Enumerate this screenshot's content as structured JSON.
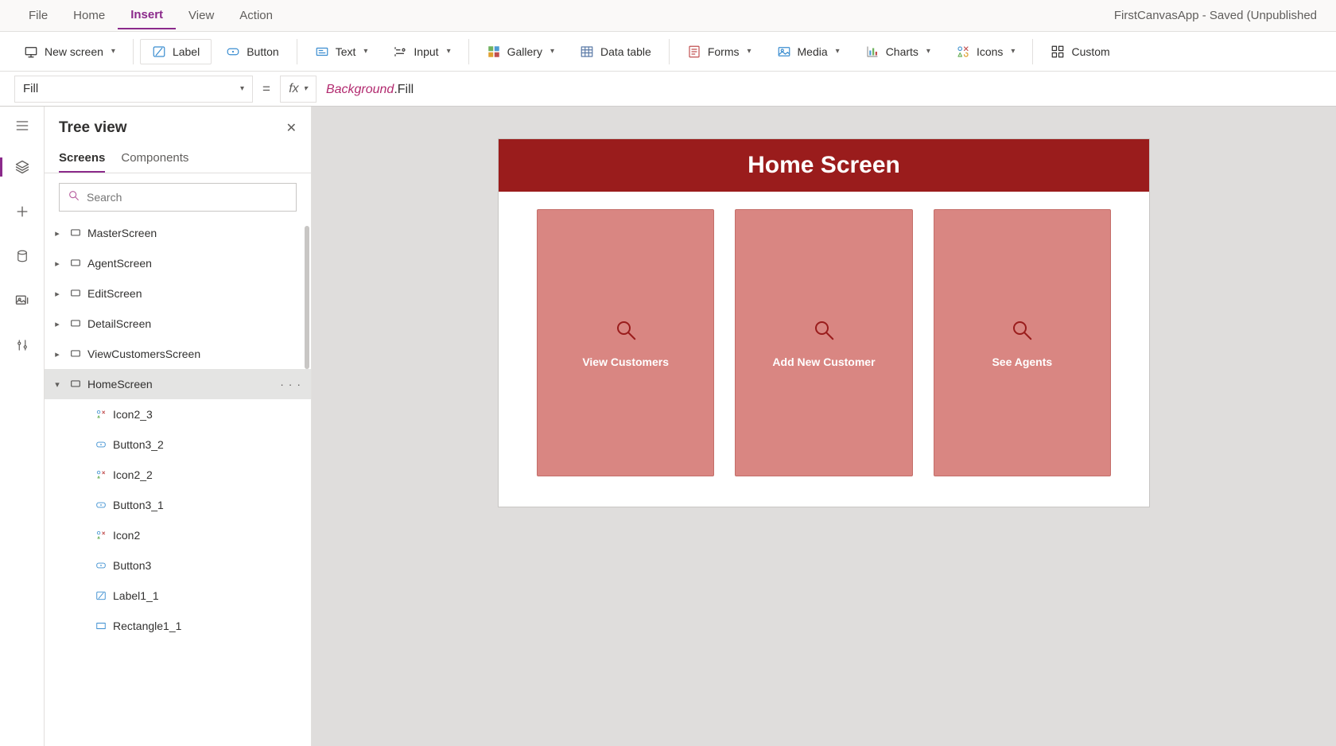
{
  "window": {
    "title": "FirstCanvasApp - Saved (Unpublished"
  },
  "menu": {
    "items": [
      "File",
      "Home",
      "Insert",
      "View",
      "Action"
    ],
    "active": "Insert"
  },
  "ribbon": {
    "new_screen": "New screen",
    "label": "Label",
    "button": "Button",
    "text": "Text",
    "input": "Input",
    "gallery": "Gallery",
    "data_table": "Data table",
    "forms": "Forms",
    "media": "Media",
    "charts": "Charts",
    "icons": "Icons",
    "custom": "Custom"
  },
  "formula": {
    "property": "Fill",
    "equals": "=",
    "fx": "fx",
    "expr_object": "Background",
    "expr_dot": ".",
    "expr_prop": "Fill"
  },
  "tree": {
    "title": "Tree view",
    "tabs": {
      "screens": "Screens",
      "components": "Components"
    },
    "search_placeholder": "Search",
    "nodes": [
      {
        "label": "MasterScreen",
        "type": "screen",
        "expanded": false,
        "depth": 1
      },
      {
        "label": "AgentScreen",
        "type": "screen",
        "expanded": false,
        "depth": 1
      },
      {
        "label": "EditScreen",
        "type": "screen",
        "expanded": false,
        "depth": 1
      },
      {
        "label": "DetailScreen",
        "type": "screen",
        "expanded": false,
        "depth": 1
      },
      {
        "label": "ViewCustomersScreen",
        "type": "screen",
        "expanded": false,
        "depth": 1
      },
      {
        "label": "HomeScreen",
        "type": "screen",
        "expanded": true,
        "selected": true,
        "more": true,
        "depth": 1
      },
      {
        "label": "Icon2_3",
        "type": "icon",
        "depth": 2
      },
      {
        "label": "Button3_2",
        "type": "button",
        "depth": 2
      },
      {
        "label": "Icon2_2",
        "type": "icon",
        "depth": 2
      },
      {
        "label": "Button3_1",
        "type": "button",
        "depth": 2
      },
      {
        "label": "Icon2",
        "type": "icon",
        "depth": 2
      },
      {
        "label": "Button3",
        "type": "button",
        "depth": 2
      },
      {
        "label": "Label1_1",
        "type": "label",
        "depth": 2
      },
      {
        "label": "Rectangle1_1",
        "type": "rect",
        "depth": 2
      }
    ]
  },
  "canvas": {
    "header": "Home Screen",
    "cards": [
      {
        "label": "View Customers"
      },
      {
        "label": "Add New Customer"
      },
      {
        "label": "See Agents"
      }
    ]
  },
  "colors": {
    "maroon": "#9a1c1c",
    "card": "#d98682",
    "accent": "#8b2a8b"
  }
}
